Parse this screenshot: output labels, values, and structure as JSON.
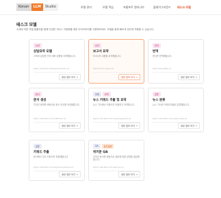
{
  "header": {
    "brand": [
      "Konan",
      "LLM",
      "Studio"
    ],
    "nav": [
      "모델 관리",
      "모델 학습",
      "프롬프트 엔지니어",
      "플레이그라운드",
      "테스크 모델"
    ]
  },
  "page": {
    "title": "테스크 모델",
    "subtitle": "주제에 따른 모델 템플릿을 통해 다양한 서비스 자동화를 위한 라이브러리를 사용해보세요. 모델을 통해 빠르게 업무에 적용할 수 있습니다."
  },
  "cards": [
    {
      "tags": [
        "요약"
      ],
      "title": "상담요약 모델",
      "desc": "고객과 상담원 간의 대화 내용을 요약해줍니다.",
      "path": "kyllm-13b-tech-dialog-summary-v1",
      "button": "세부 정보 보기 →",
      "selected": false
    },
    {
      "tags": [
        "요약"
      ],
      "title": "보고서 요약",
      "desc": "보고서의 내용을 요약해줍니다.",
      "path": "kyllm-tech-report-v1",
      "button": "세부 정보 보기 →",
      "selected": true
    },
    {
      "tags": [
        "번역"
      ],
      "title": "번역",
      "desc": "문서를 번역해줍니다.",
      "path": "kyllm-translate-v1",
      "button": "세부 정보 보기 →",
      "selected": false
    },
    {
      "tags": [
        "문서"
      ],
      "title": "문서 생성",
      "desc": "주어진 정보를 바탕으로 문서 초안을 작성해줍니다.",
      "path": "kyllm-13b-tech-3.0-draft-doc-v1",
      "button": "세부 정보 보기 →",
      "selected": false
    },
    {
      "tags": [
        "주제",
        "요약"
      ],
      "title": "뉴스 키워드 추출 및 요약",
      "desc": "뉴스 기사에서 키워드를 추출하고 요약합니다.",
      "path": "kyllm-13b-tech-3.0-news-keyword-v1",
      "button": "세부 정보 보기 →",
      "selected": false
    },
    {
      "tags": [
        "분류"
      ],
      "title": "뉴스 분류",
      "desc": "뉴스 기사를 카테고리별로 분류해줍니다.",
      "path": "kyllm-13b-tech-3.0-news-class-v1",
      "button": "세부 정보 보기 →",
      "selected": false
    },
    {
      "tags": [
        "분류"
      ],
      "title": "키워드 추출",
      "desc": "문서에서 주요 키워드를 추출해줍니다.",
      "path": "kyllm-13b-tech-3.0-keyword-extract-v1",
      "button": "세부 정보 보기 →",
      "selected": false
    },
    {
      "tags": [
        "QA",
        "유사질의"
      ],
      "title": "위키문 QA",
      "desc": "주어진 문서를 바탕으로 질문에 대한 답변을 생성해줍니다.",
      "path": "kyllm-13b-tech-3.0-wiki-qa-v1",
      "button": "세부 정보 보기 →",
      "selected": false
    }
  ]
}
